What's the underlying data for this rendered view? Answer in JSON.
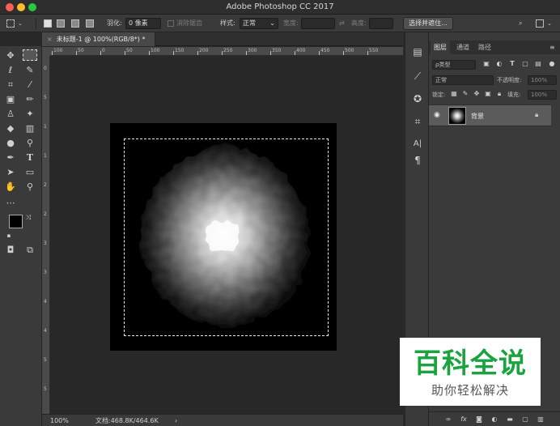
{
  "window": {
    "title": "Adobe Photoshop CC 2017"
  },
  "options_bar": {
    "feather_label": "羽化:",
    "feather_value": "0 像素",
    "antialias_label": "消除锯齿",
    "style_label": "样式:",
    "style_value": "正常",
    "width_label": "宽度:",
    "height_label": "高度:",
    "select_mask_button": "选择并遮住..."
  },
  "document_tab": {
    "close_glyph": "×",
    "title": "未标题-1 @ 100%(RGB/8*) *"
  },
  "rulers": {
    "top_labels": [
      "100",
      "50",
      "0",
      "50",
      "100",
      "150",
      "200",
      "250",
      "300",
      "350",
      "400",
      "450",
      "500",
      "550"
    ],
    "left_labels": [
      "0",
      "5",
      "1",
      "1",
      "2",
      "2",
      "3",
      "3",
      "4",
      "4",
      "5",
      "5"
    ]
  },
  "status_bar": {
    "zoom": "100%",
    "doc_info": "文档:468.8K/464.6K",
    "arrow": "›"
  },
  "layers_panel": {
    "tabs": [
      "图层",
      "通道",
      "路径"
    ],
    "filter_kind": "ρ类型",
    "blend_mode": "正常",
    "opacity_label": "不透明度:",
    "opacity_value": "100%",
    "lock_label": "锁定:",
    "fill_label": "填充:",
    "fill_value": "100%",
    "layer_name": "背景"
  },
  "watermark": {
    "title": "百科全说",
    "subtitle": "助你轻松解决"
  },
  "colors": {
    "ui_dark": "#3a3a3a",
    "canvas_bg": "#282828",
    "layer_selected": "#5b5b5b",
    "watermark_green": "#1aa33f"
  }
}
